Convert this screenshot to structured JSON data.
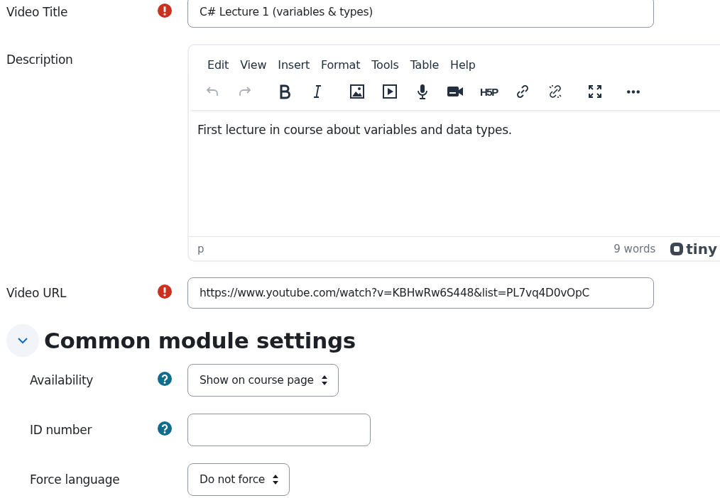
{
  "fields": [
    {
      "kind": "text",
      "label": "Video Title",
      "required": true,
      "value": "C# Lecture 1 (variables & types)"
    },
    {
      "kind": "editor",
      "label": "Description",
      "required": false,
      "menu": [
        "Edit",
        "View",
        "Insert",
        "Format",
        "Tools",
        "Table",
        "Help"
      ],
      "toolbar": [
        {
          "kind": "undo",
          "disabled": true
        },
        {
          "kind": "redo",
          "disabled": true
        },
        {
          "kind": "bold",
          "disabled": false
        },
        {
          "kind": "italic",
          "disabled": false
        },
        {
          "kind": "image",
          "disabled": false
        },
        {
          "kind": "media",
          "disabled": false
        },
        {
          "kind": "mic",
          "disabled": false
        },
        {
          "kind": "camera",
          "disabled": false
        },
        {
          "kind": "h5p",
          "label": "H5P",
          "disabled": false
        },
        {
          "kind": "link",
          "disabled": false
        },
        {
          "kind": "unlink",
          "disabled": false
        },
        {
          "kind": "fullscreen",
          "disabled": false
        },
        {
          "kind": "more",
          "disabled": false
        }
      ],
      "content": "First lecture in course about variables and data types.",
      "path": "p",
      "word_count": "9 words",
      "brand": "tiny"
    },
    {
      "kind": "text",
      "label": "Video URL",
      "required": true,
      "value": "https://www.youtube.com/watch?v=KBHwRw6S448&list=PL7vq4D0vOpC"
    }
  ],
  "section": {
    "title": "Common module settings",
    "expanded": true,
    "fields": [
      {
        "kind": "select",
        "label": "Availability",
        "help": true,
        "value": "Show on course page"
      },
      {
        "kind": "text",
        "label": "ID number",
        "help": true
      },
      {
        "kind": "select",
        "label": "Force language",
        "help": false,
        "value": "Do not force"
      }
    ]
  }
}
